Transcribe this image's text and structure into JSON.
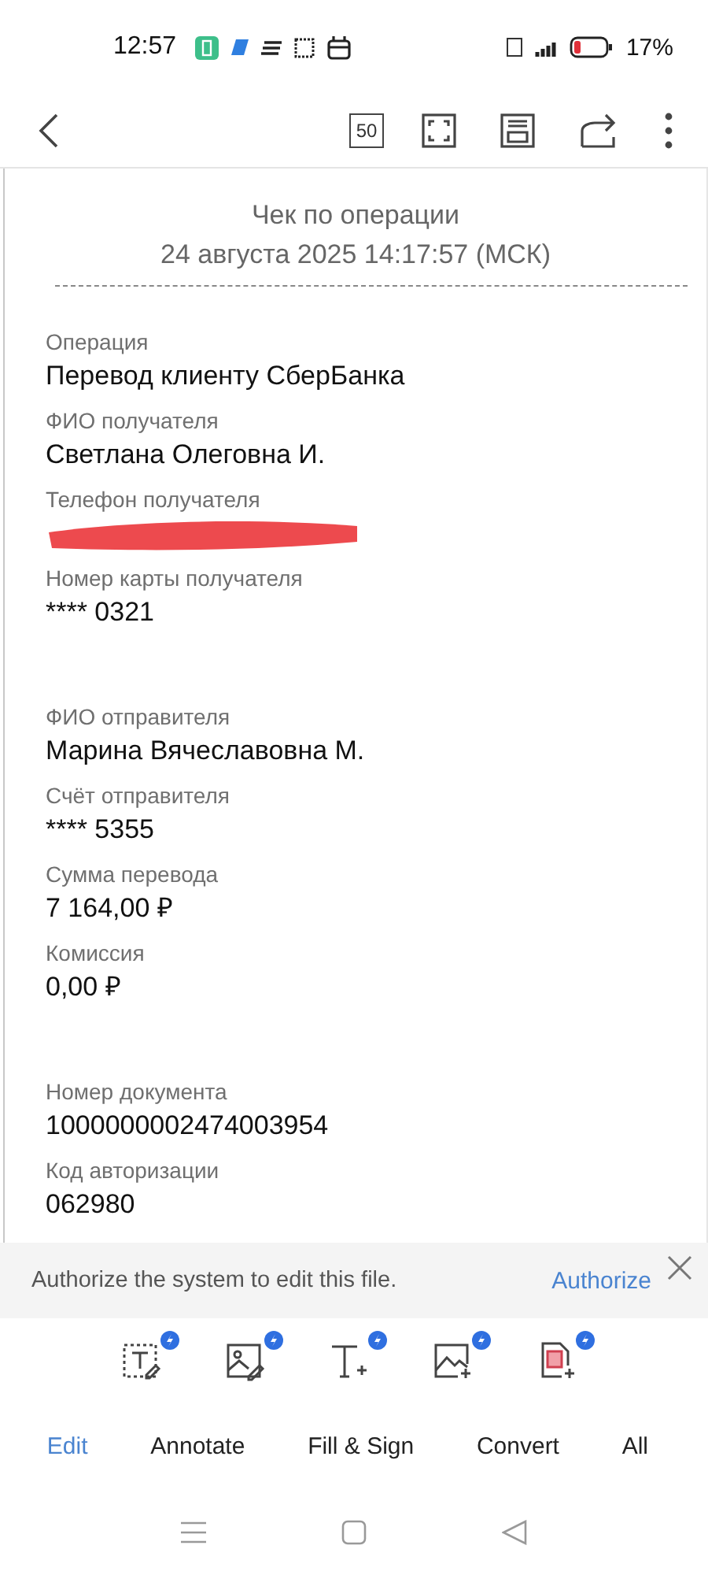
{
  "status_bar": {
    "time": "12:57",
    "battery": "17%"
  },
  "toolbar": {
    "page_button": "50"
  },
  "receipt": {
    "title": "Чек по операции",
    "date": "24 августа 2025 14:17:57 (МСК)",
    "groups": [
      [
        {
          "label": "Операция",
          "value": "Перевод клиенту СберБанка"
        },
        {
          "label": "ФИО получателя",
          "value": "Светлана Олеговна И."
        },
        {
          "label": "Телефон получателя",
          "redacted": true
        },
        {
          "label": "Номер карты получателя",
          "value": "**** 0321"
        }
      ],
      [
        {
          "label": "ФИО отправителя",
          "value": "Марина Вячеславовна М."
        },
        {
          "label": "Счёт отправителя",
          "value": "**** 5355"
        },
        {
          "label": "Сумма перевода",
          "value": "7 164,00 ₽"
        },
        {
          "label": "Комиссия",
          "value": "0,00 ₽"
        }
      ],
      [
        {
          "label": "Номер документа",
          "value": "1000000002474003954"
        },
        {
          "label": "Код авторизации",
          "value": "062980"
        }
      ]
    ]
  },
  "banner": {
    "message": "Authorize the system to edit this file.",
    "action": "Authorize"
  },
  "tabs": [
    {
      "label": "Edit",
      "selected": true
    },
    {
      "label": "Annotate",
      "selected": false
    },
    {
      "label": "Fill & Sign",
      "selected": false
    },
    {
      "label": "Convert",
      "selected": false
    },
    {
      "label": "All",
      "selected": false
    }
  ]
}
